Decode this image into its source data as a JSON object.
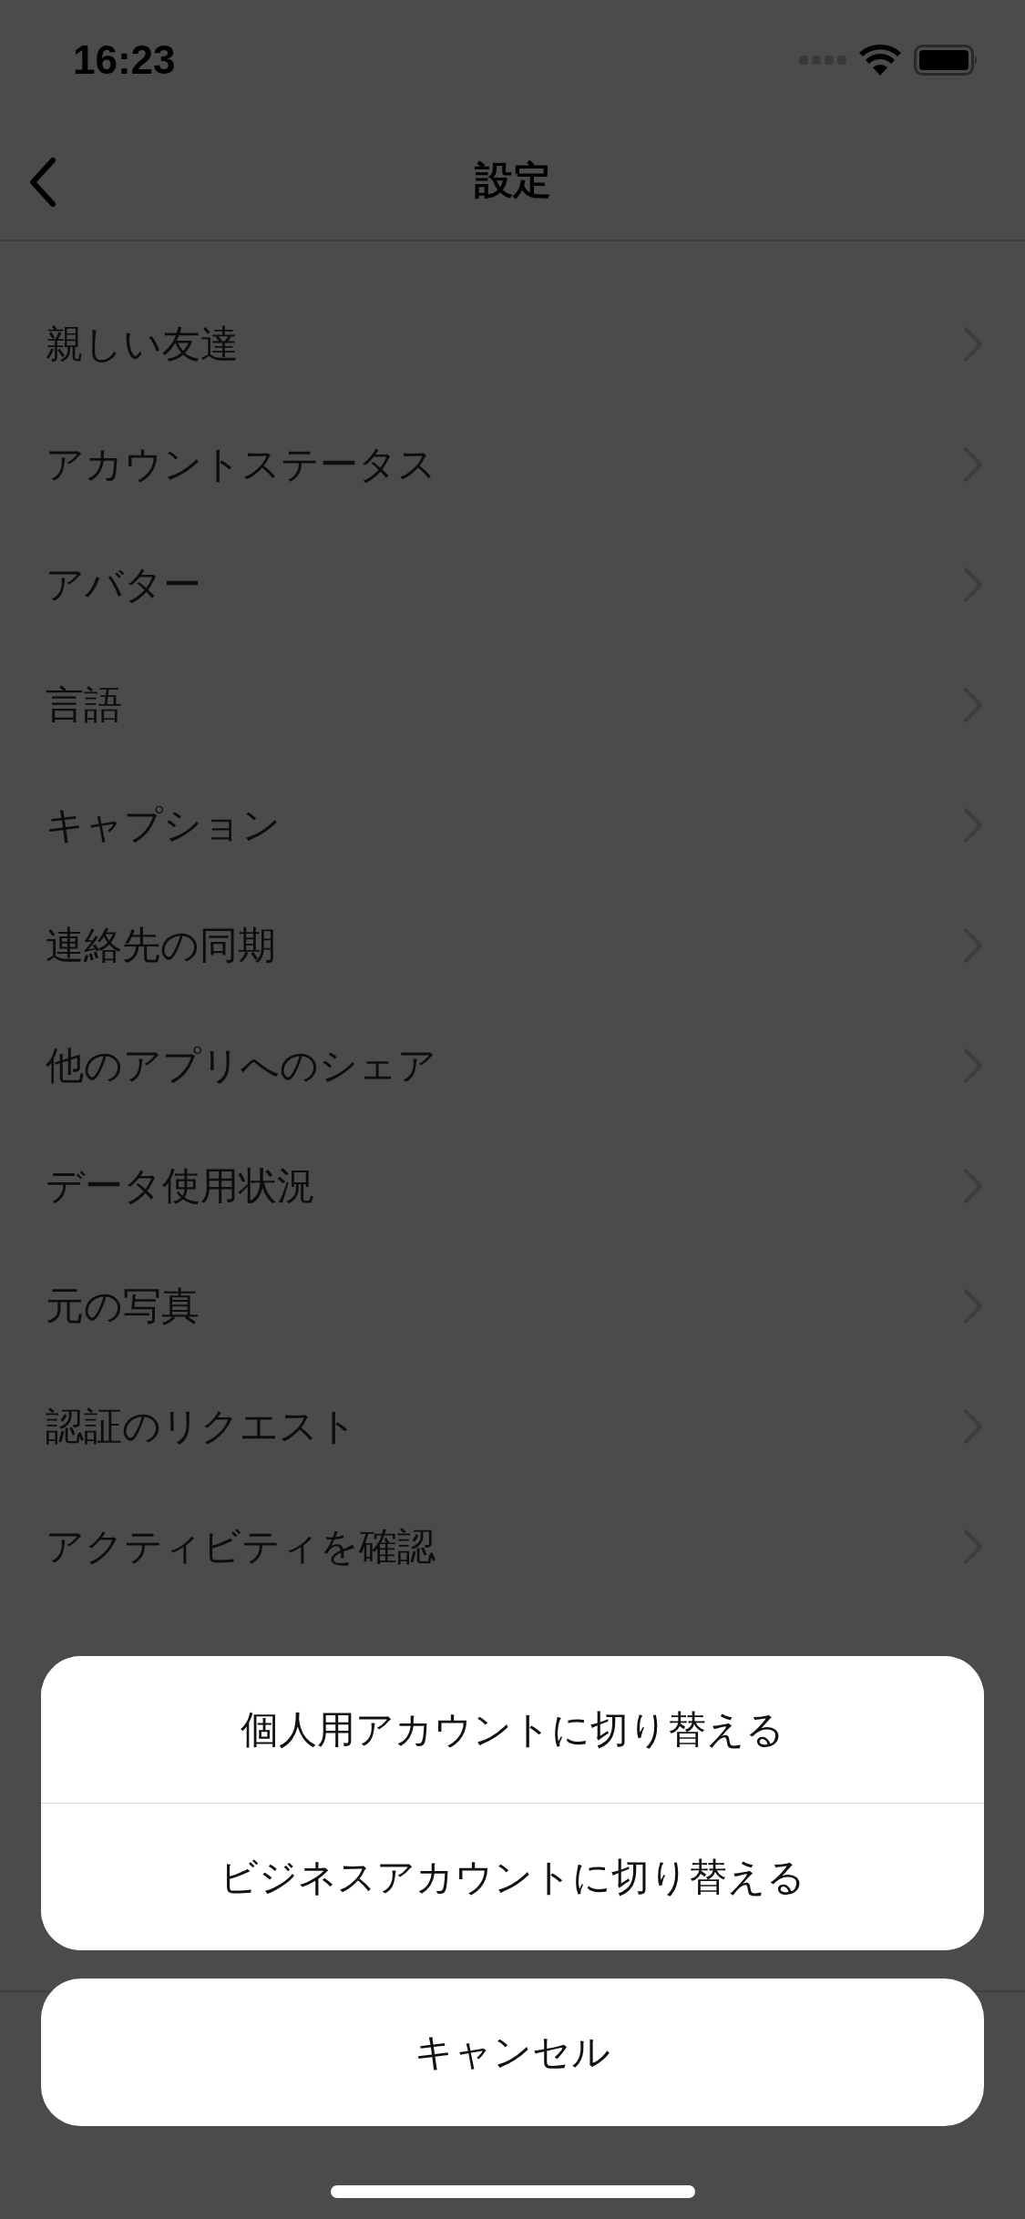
{
  "status_bar": {
    "time": "16:23"
  },
  "nav": {
    "title": "設定"
  },
  "rows": [
    {
      "label": "親しい友達"
    },
    {
      "label": "アカウントステータス"
    },
    {
      "label": "アバター"
    },
    {
      "label": "言語"
    },
    {
      "label": "キャプション"
    },
    {
      "label": "連絡先の同期"
    },
    {
      "label": "他のアプリへのシェア"
    },
    {
      "label": "データ使用状況"
    },
    {
      "label": "元の写真"
    },
    {
      "label": "認証のリクエスト"
    },
    {
      "label": "アクティビティを確認"
    }
  ],
  "action_sheet": {
    "actions": [
      "個人用アカウントに切り替える",
      "ビジネスアカウントに切り替える"
    ],
    "cancel": "キャンセル"
  }
}
